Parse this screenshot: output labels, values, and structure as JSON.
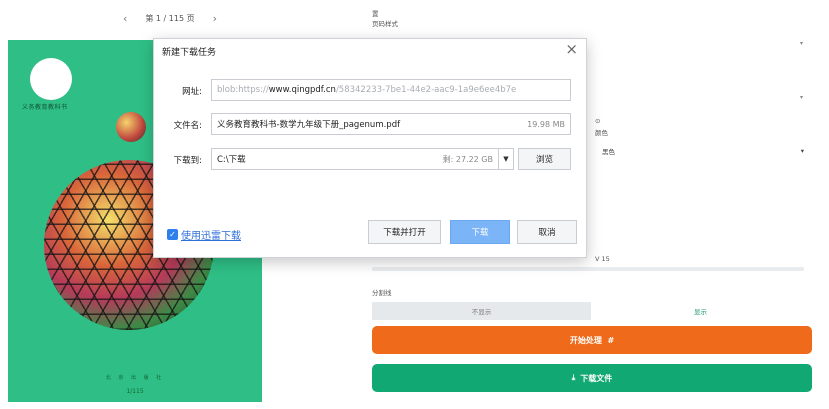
{
  "pager": {
    "prev_icon": "chevron-left-icon",
    "next_icon": "chevron-right-icon",
    "text": "第 1 / 115 页"
  },
  "cover": {
    "title": "义务教育教科书",
    "publisher": "北 京 出 版 社",
    "page": "1/115"
  },
  "side_panel": {
    "top_char": "置",
    "page_style_label": "页码样式",
    "color_label": "颜色",
    "color_value": "黑色",
    "range_value": "V 15",
    "divider_label": "分割线",
    "divider_off": "不显示",
    "divider_on": "显示",
    "start_label": "开始处理",
    "start_suffix": "#",
    "download_label": "下载文件",
    "download_icon": "download-icon",
    "start_color": "#ef6a1a",
    "download_color": "#12a874"
  },
  "dialog": {
    "title": "新建下载任务",
    "close_icon": "close-icon",
    "url_label": "网址:",
    "url_prefix": "blob:https://",
    "url_host": "www.qingpdf.cn",
    "url_rest": "/58342233-7be1-44e2-aac9-1a9e6ee4b7e",
    "filename_label": "文件名:",
    "filename": "义务教育教科书-数学九年级下册_pagenum.pdf",
    "filesize": "19.98 MB",
    "saveto_label": "下载到:",
    "saveto_path": "C:\\下载",
    "free_space": "剩: 27.22 GB",
    "dropdown_icon": "caret-down-icon",
    "browse_label": "浏览",
    "xunlei_label": "使用迅雷下载",
    "xunlei_checked": true,
    "download_open_label": "下载并打开",
    "download_label": "下载",
    "cancel_label": "取消",
    "accent_color": "#7bb4f7"
  }
}
